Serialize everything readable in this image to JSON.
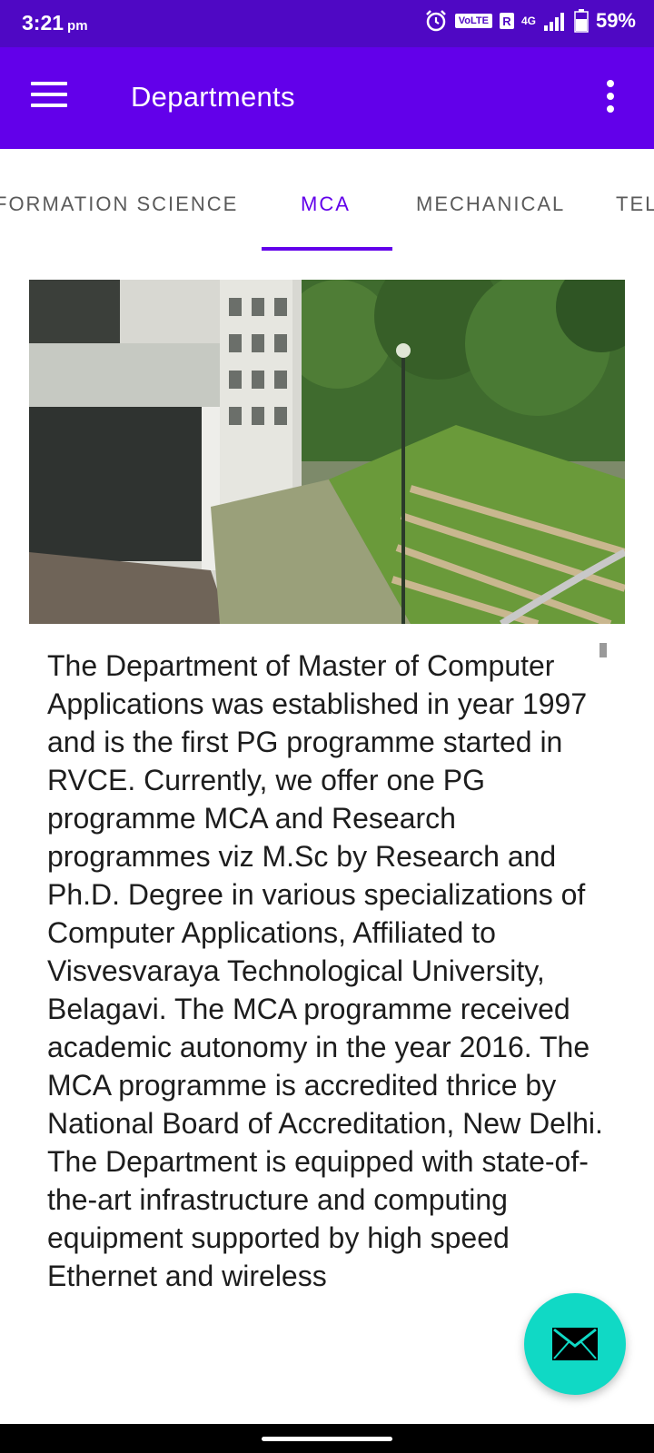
{
  "status_bar": {
    "time": "3:21",
    "time_suffix": "pm",
    "volte": "VoLTE",
    "roaming": "R",
    "network": "4G",
    "battery": "59%"
  },
  "app_bar": {
    "title": "Departments",
    "menu_icon": "hamburger-menu-icon",
    "overflow_icon": "more-vertical-icon"
  },
  "tabs": [
    {
      "label": "FORMATION SCIENCE",
      "active": false
    },
    {
      "label": "MCA",
      "active": true
    },
    {
      "label": "MECHANICAL",
      "active": false
    },
    {
      "label": "TEL",
      "active": false
    }
  ],
  "content": {
    "description": "The Department of Master of Computer Applications was established in year 1997 and is the first PG programme started in RVCE. Currently, we offer one PG programme MCA and Research programmes viz M.Sc by Research and Ph.D. Degree in various specializations of Computer Applications, Affiliated to Visvesvaraya Technological University, Belagavi. The MCA programme received academic autonomy in the year 2016. The MCA programme is accredited thrice by National Board of Accreditation, New Delhi. The Department is equipped with state-of-the-art infrastructure and computing equipment supported by high speed Ethernet and wireless"
  },
  "fab": {
    "icon": "mail-icon"
  },
  "colors": {
    "status_bar": "#4f08c4",
    "app_bar": "#6200ea",
    "accent": "#6200ea",
    "fab": "#10d9c5"
  }
}
